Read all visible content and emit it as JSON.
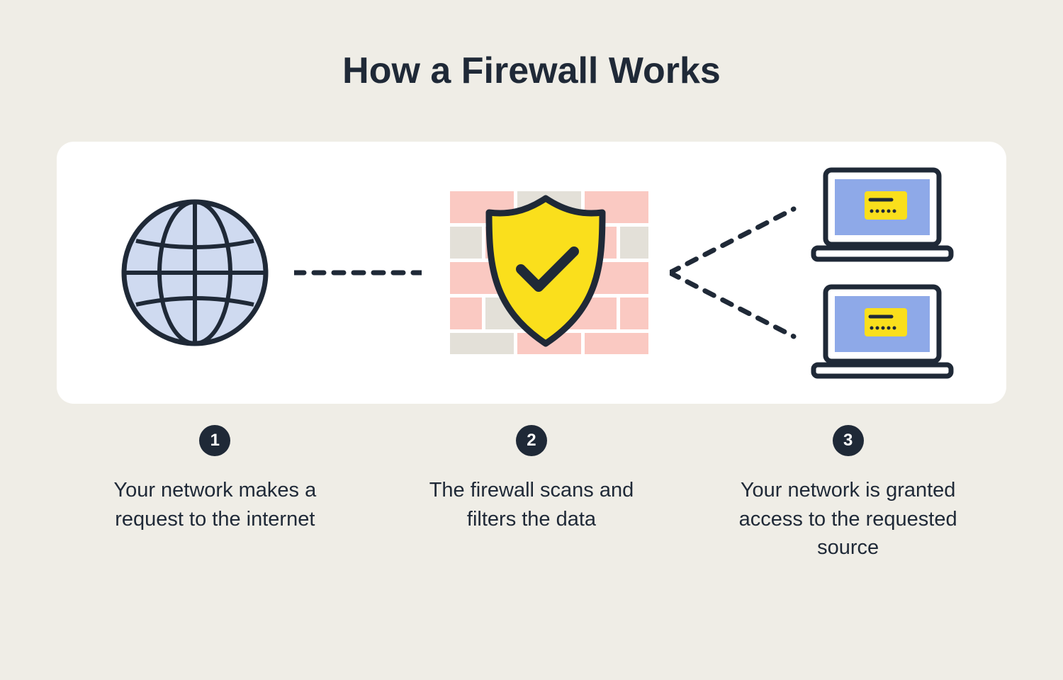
{
  "title": "How a Firewall Works",
  "colors": {
    "background": "#efede6",
    "card": "#ffffff",
    "text": "#1f2937",
    "badge_bg": "#1f2937",
    "badge_text": "#ffffff",
    "globe_fill": "#cfdaf0",
    "shield_fill": "#fadf1c",
    "brick_pink": "#fac9c2",
    "brick_gray": "#e3e0d8",
    "laptop_screen": "#8ea9e8",
    "laptop_card": "#fadf1c"
  },
  "steps": [
    {
      "number": "1",
      "text": "Your network makes a request to the internet",
      "icon": "globe-icon"
    },
    {
      "number": "2",
      "text": "The firewall scans and filters the data",
      "icon": "firewall-shield-icon"
    },
    {
      "number": "3",
      "text": "Your network is granted access to the requested source",
      "icon": "laptops-icon"
    }
  ]
}
